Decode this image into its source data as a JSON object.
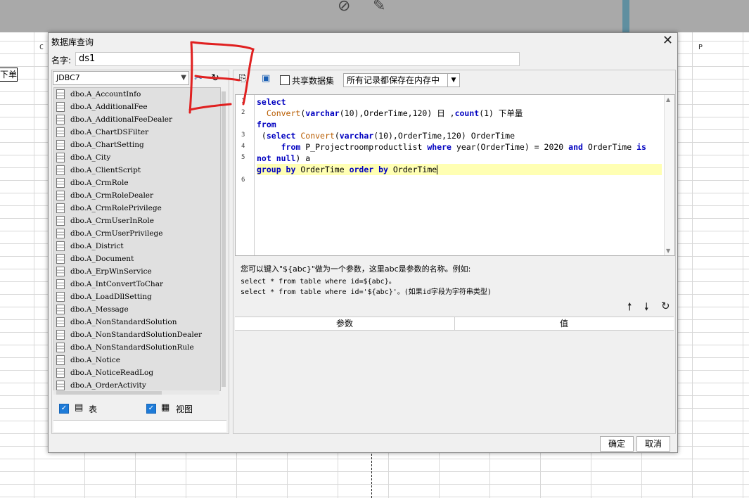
{
  "background": {
    "column_c": "C",
    "column_p": "P",
    "cell_text": "下单"
  },
  "dialog": {
    "title": "数据库查询",
    "close_glyph": "✕",
    "name_label": "名字:",
    "name_value": "ds1",
    "connection": "JDBC7",
    "tables": [
      "dbo.A_AccountInfo",
      "dbo.A_AdditionalFee",
      "dbo.A_AdditionalFeeDealer",
      "dbo.A_ChartDSFilter",
      "dbo.A_ChartSetting",
      "dbo.A_City",
      "dbo.A_ClientScript",
      "dbo.A_CrmRole",
      "dbo.A_CrmRoleDealer",
      "dbo.A_CrmRolePrivilege",
      "dbo.A_CrmUserInRole",
      "dbo.A_CrmUserPrivilege",
      "dbo.A_District",
      "dbo.A_Document",
      "dbo.A_ErpWinService",
      "dbo.A_IntConvertToChar",
      "dbo.A_LoadDllSetting",
      "dbo.A_Message",
      "dbo.A_NonStandardSolution",
      "dbo.A_NonStandardSolutionDealer",
      "dbo.A_NonStandardSolutionRule",
      "dbo.A_Notice",
      "dbo.A_NoticeReadLog",
      "dbo.A_OrderActivity"
    ],
    "filter_table_label": "表",
    "filter_view_label": "视图",
    "share_dataset_label": "共享数据集",
    "cache_mode": "所有记录都保存在内存中",
    "sql_line_numbers": [
      "1",
      "2",
      "3",
      "4",
      "5",
      "6"
    ],
    "hint_line1": "您可以键入\"${abc}\"做为一个参数，这里abc是参数的名称。例如:",
    "hint_line2": "select * from table where id=${abc}。",
    "hint_line3": "select * from table where id='${abc}'。(如果id字段为字符串类型)",
    "param_col_name": "参数",
    "param_col_value": "值",
    "ok_label": "确定",
    "cancel_label": "取消"
  },
  "colors": {
    "keyword": "#0000c0",
    "function": "#b85c00",
    "current_line": "#ffffb3",
    "checkbox": "#1e7bd8",
    "annotation": "#e02020"
  }
}
